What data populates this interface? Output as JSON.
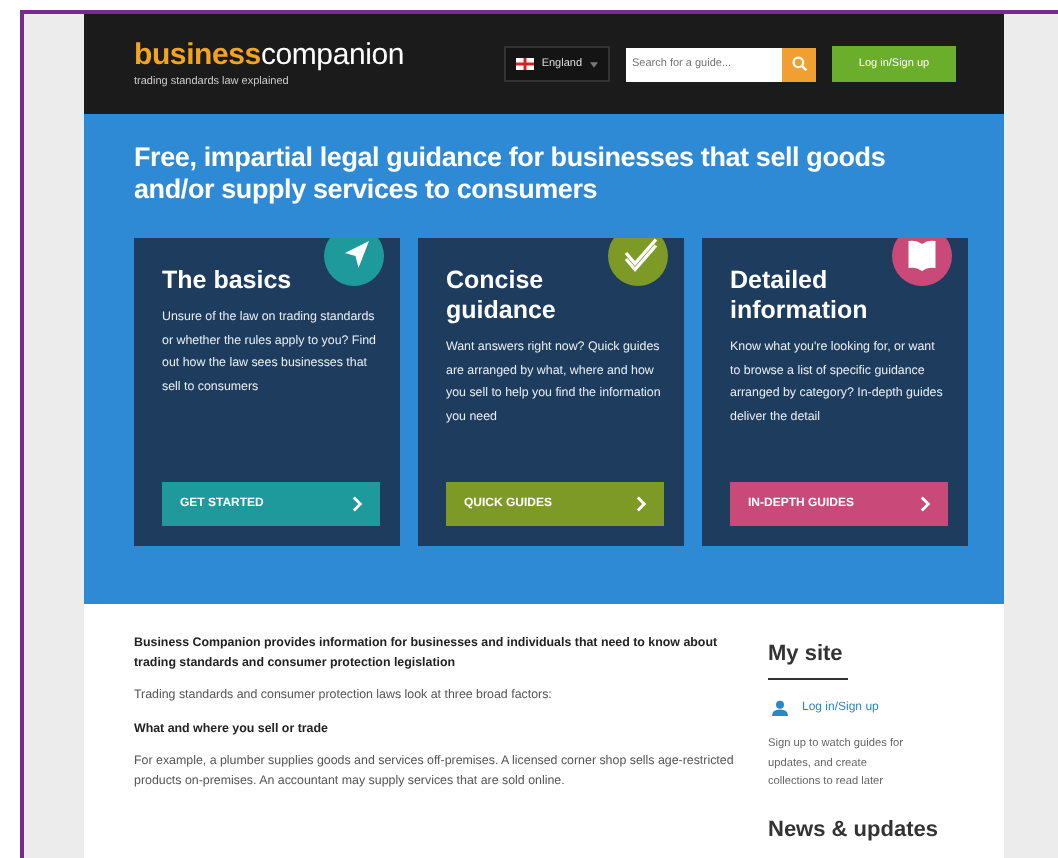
{
  "header": {
    "logo_primary": "business",
    "logo_secondary": "companion",
    "tagline": "trading standards law explained",
    "country": "England",
    "search": {
      "placeholder": "Search for a guide..."
    },
    "login_button": "Log in/Sign up"
  },
  "hero": {
    "title": "Free, impartial legal guidance for businesses that sell goods and/or supply services to consumers",
    "cards": [
      {
        "kind": "arrow",
        "color": "#1e9a9c",
        "title": "The basics",
        "text": "Unsure of the law on trading standards or whether the rules apply to you? Find out how the law sees businesses that sell to consumers",
        "button": "GET STARTED"
      },
      {
        "kind": "check",
        "color": "#7d9a26",
        "title": "Concise guidance",
        "text": "Want answers right now? Quick guides are arranged by what, where and how you sell to help you find the information you need",
        "button": "QUICK GUIDES"
      },
      {
        "kind": "book",
        "color": "#c94a78",
        "title": "Detailed information",
        "text": "Know what you're looking for, or want to browse a list of specific guidance arranged by category? In-depth guides deliver the detail",
        "button": "IN-DEPTH GUIDES"
      }
    ]
  },
  "main": {
    "paragraphs": [
      {
        "kind": "lead",
        "text": "Business Companion provides information for businesses and individuals that need to know about trading standards and consumer protection legislation"
      },
      {
        "kind": "body",
        "text": "Trading standards and consumer protection laws look at three broad factors:"
      },
      {
        "kind": "heading",
        "text": "What and where you sell or trade"
      },
      {
        "kind": "body",
        "text": "For example, a plumber supplies goods and services off-premises. A licensed corner shop sells age-restricted products on-premises. An accountant may supply services that are sold online."
      }
    ]
  },
  "sidebar": {
    "title": "My site",
    "login_link": "Log in/Sign up",
    "note": "Sign up to watch guides for updates, and create collections to read later",
    "news_title": "News & updates"
  }
}
